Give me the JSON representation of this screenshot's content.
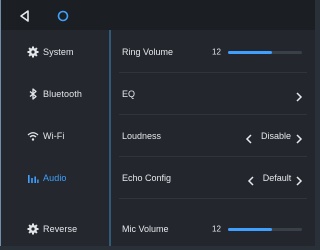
{
  "statusbar": {
    "back_icon": "back-triangle-icon",
    "home_icon": "home-circle-icon"
  },
  "sidebar": {
    "items": [
      {
        "label": "System",
        "icon": "gear-icon",
        "active": false
      },
      {
        "label": "Bluetooth",
        "icon": "bluetooth-icon",
        "active": false
      },
      {
        "label": "Wi-Fi",
        "icon": "wifi-icon",
        "active": false
      },
      {
        "label": "Audio",
        "icon": "equalizer-bars-icon",
        "active": true
      },
      {
        "label": "Reverse",
        "icon": "gear-icon",
        "active": false
      }
    ]
  },
  "settings": {
    "ring_volume": {
      "label": "Ring Volume",
      "value": "12",
      "fraction": 0.6
    },
    "eq": {
      "label": "EQ"
    },
    "loudness": {
      "label": "Loudness",
      "value": "Disable"
    },
    "echo_config": {
      "label": "Echo Config",
      "value": "Default"
    },
    "mic_volume": {
      "label": "Mic Volume",
      "value": "12",
      "fraction": 0.6
    }
  },
  "colors": {
    "accent": "#3fa0ff",
    "background": "#23272d",
    "divider": "#2f5a78",
    "text": "#e6e8eb"
  }
}
